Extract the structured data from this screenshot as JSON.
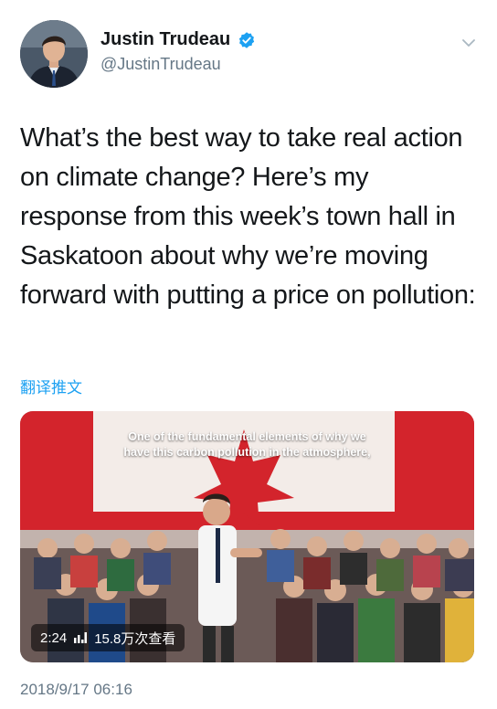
{
  "tweet": {
    "author": {
      "display_name": "Justin Trudeau",
      "handle": "@JustinTrudeau",
      "verified": true
    },
    "text": "What’s the best way to take real action on climate change? Here’s my response from this week’s town hall in Saskatoon about why we’re moving forward with putting a price on pollution:",
    "translate_label": "翻译推文",
    "video": {
      "subtitle_line1": "One of the fundamental elements of why we",
      "subtitle_line2": "have this carbon pollution in the atmosphere,",
      "duration": "2:24",
      "views": "15.8万次查看"
    },
    "timestamp": "2018/9/17 06:16"
  },
  "colors": {
    "accent": "#1da1f2",
    "secondary_text": "#657786",
    "flag_red": "#d3242c"
  }
}
